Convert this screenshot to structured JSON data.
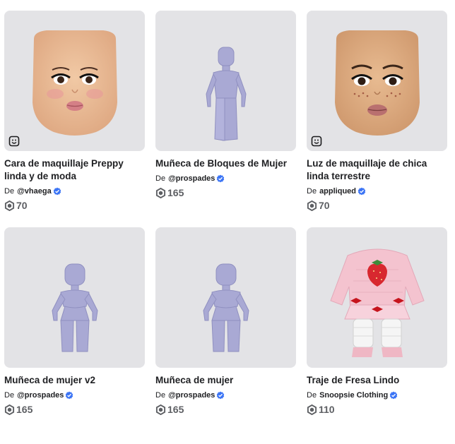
{
  "items": [
    {
      "name": "Cara de maquillaje Preppy linda y de moda",
      "by": "De",
      "creator": "@vhaega",
      "price": "70",
      "thumb": "face-icon"
    },
    {
      "name": "Muñeca de Bloques de Mujer",
      "by": "De",
      "creator": "@prospades",
      "price": "165",
      "thumb": "mannequin"
    },
    {
      "name": "Luz de maquillaje de chica linda terrestre",
      "by": "De",
      "creator": "appliqued",
      "price": "70",
      "thumb": "face-icon"
    },
    {
      "name": "Muñeca de mujer v2",
      "by": "De",
      "creator": "@prospades",
      "price": "165",
      "thumb": "mannequin"
    },
    {
      "name": "Muñeca de mujer",
      "by": "De",
      "creator": "@prospades",
      "price": "165",
      "thumb": "mannequin"
    },
    {
      "name": "Traje de Fresa Lindo",
      "by": "De",
      "creator": "Snoopsie Clothing",
      "price": "110",
      "thumb": "outfit"
    }
  ],
  "colors": {
    "thumb_bg": "#e3e3e6",
    "verified": "#3b74f5",
    "price": "#5d5f63",
    "mannequin": "#a9a9d4"
  }
}
